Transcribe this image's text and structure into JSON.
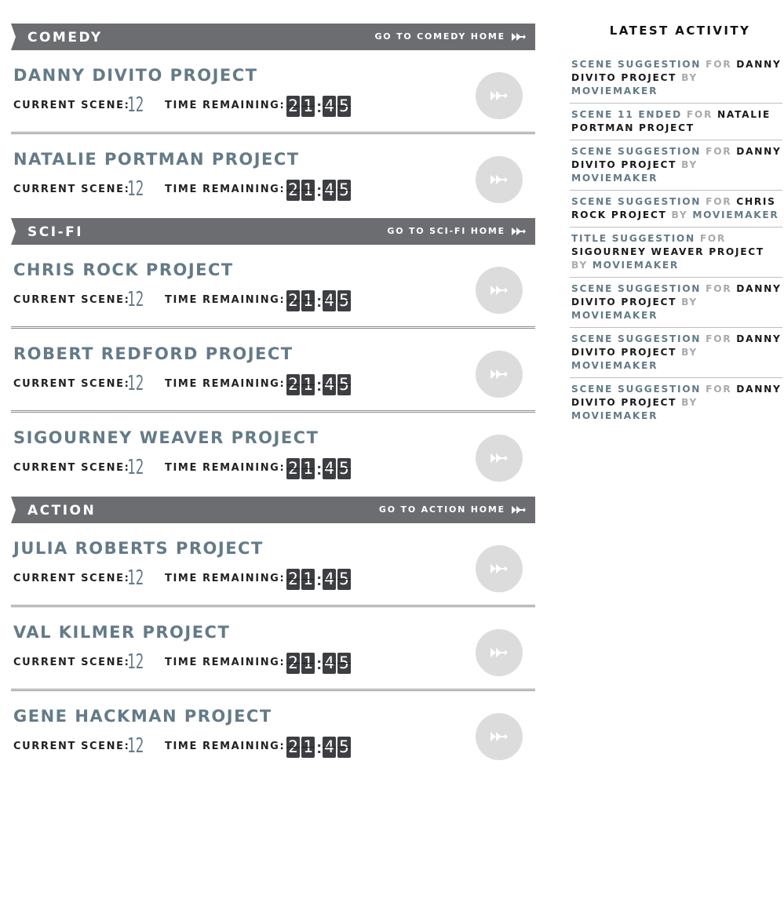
{
  "labels": {
    "current_scene": "CURRENT SCENE:",
    "time_remaining": "TIME REMAINING:"
  },
  "categories": [
    {
      "name": "COMEDY",
      "link": "GO TO COMEDY HOME",
      "projects": [
        {
          "title": "DANNY DIVITO PROJECT",
          "scene": "12",
          "time": [
            "2",
            "1",
            "4",
            "5"
          ]
        },
        {
          "title": "NATALIE PORTMAN PROJECT",
          "scene": "12",
          "time": [
            "2",
            "1",
            "4",
            "5"
          ]
        }
      ]
    },
    {
      "name": "SCI-FI",
      "link": "GO TO SCI-FI HOME",
      "projects": [
        {
          "title": "CHRIS ROCK PROJECT",
          "scene": "12",
          "time": [
            "2",
            "1",
            "4",
            "5"
          ]
        },
        {
          "title": "ROBERT REDFORD PROJECT",
          "scene": "12",
          "time": [
            "2",
            "1",
            "4",
            "5"
          ]
        },
        {
          "title": "SIGOURNEY WEAVER PROJECT",
          "scene": "12",
          "time": [
            "2",
            "1",
            "4",
            "5"
          ]
        }
      ]
    },
    {
      "name": "ACTION",
      "link": "GO TO ACTION HOME",
      "projects": [
        {
          "title": "JULIA ROBERTS PROJECT",
          "scene": "12",
          "time": [
            "2",
            "1",
            "4",
            "5"
          ]
        },
        {
          "title": "VAL KILMER PROJECT",
          "scene": "12",
          "time": [
            "2",
            "1",
            "4",
            "5"
          ]
        },
        {
          "title": "GENE HACKMAN PROJECT",
          "scene": "12",
          "time": [
            "2",
            "1",
            "4",
            "5"
          ]
        }
      ]
    }
  ],
  "sidebar": {
    "title": "LATEST ACTIVITY",
    "items": [
      {
        "type": "SCENE SUGGESTION",
        "for": "FOR",
        "project": "DANNY DIVITO PROJECT",
        "by": "BY",
        "user": "MOVIEMAKER"
      },
      {
        "type": "SCENE 11 ENDED",
        "for": "FOR",
        "project": "NATALIE PORTMAN PROJECT",
        "by": "",
        "user": ""
      },
      {
        "type": "SCENE SUGGESTION",
        "for": "FOR",
        "project": "DANNY DIVITO PROJECT",
        "by": "BY",
        "user": "MOVIEMAKER"
      },
      {
        "type": "SCENE SUGGESTION",
        "for": "FOR",
        "project": "CHRIS ROCK PROJECT",
        "by": "BY",
        "user": "MOVIEMAKER"
      },
      {
        "type": "TITLE SUGGESTION",
        "for": "FOR",
        "project": "SIGOURNEY WEAVER PROJECT",
        "by": "BY",
        "user": "MOVIEMAKER"
      },
      {
        "type": "SCENE SUGGESTION",
        "for": "FOR",
        "project": "DANNY DIVITO PROJECT",
        "by": "BY",
        "user": "MOVIEMAKER"
      },
      {
        "type": "SCENE SUGGESTION",
        "for": "FOR",
        "project": "DANNY DIVITO PROJECT",
        "by": "BY",
        "user": "MOVIEMAKER"
      },
      {
        "type": "SCENE SUGGESTION",
        "for": "FOR",
        "project": "DANNY DIVITO PROJECT",
        "by": "BY",
        "user": "MOVIEMAKER"
      }
    ]
  },
  "icons": {
    "category_link": "double-arrow-icon",
    "project_button": "double-arrow-icon"
  },
  "colors": {
    "category_bar": "#6c6d71",
    "project_title": "#647b87",
    "digit_background": "#3d3e42",
    "button_circle": "#dcdcdd"
  }
}
